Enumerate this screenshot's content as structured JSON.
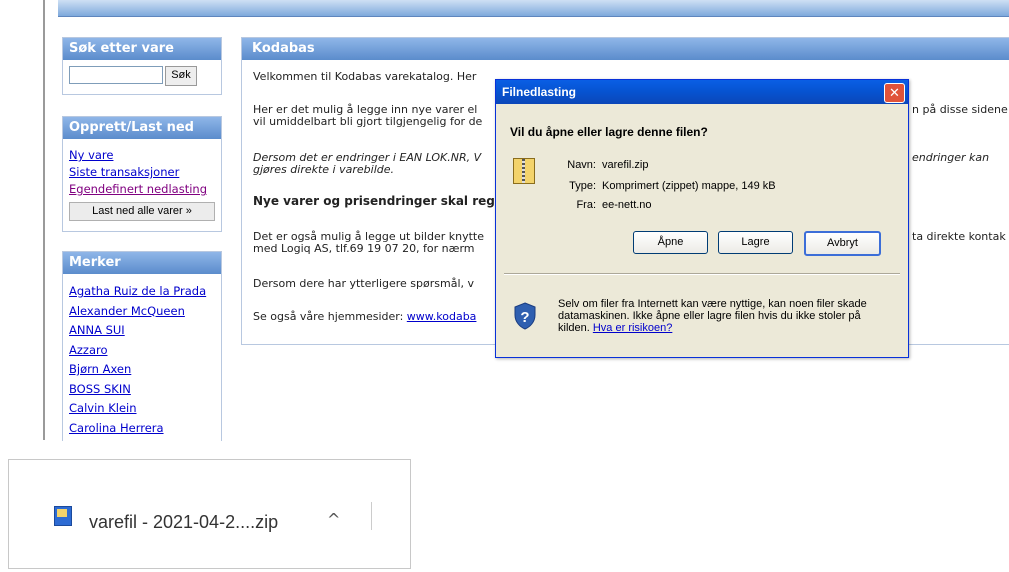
{
  "topbar": {
    "text": ""
  },
  "sidebar": {
    "search": {
      "title": "Søk etter vare",
      "button": "Søk",
      "value": ""
    },
    "create": {
      "title": "Opprett/Last ned",
      "links": [
        "Ny vare",
        "Siste transaksjoner",
        "Egendefinert nedlasting"
      ],
      "download_all": "Last ned alle varer »"
    },
    "brands": {
      "title": "Merker",
      "items": [
        "Agatha Ruiz de la Prada",
        "Alexander McQueen",
        "ANNA SUI",
        "Azzaro",
        "Bjørn Axen",
        "BOSS SKIN",
        "Calvin Klein",
        "Carolina Herrera"
      ]
    }
  },
  "main": {
    "title": "Kodabas",
    "p1": "Velkommen til Kodabas varekatalog. Her",
    "p2a": "Her er det mulig å legge inn nye varer el",
    "p2a_end": "n på disse sidene",
    "p2b": "vil umiddelbart bli gjort tilgjengelig for de",
    "p3a": "Dersom det er endringer i EAN LOK.NR, V",
    "p3a_end": "endringer kan",
    "p3b": "gjøres direkte i varebilde.",
    "h": "Nye varer og prisendringer skal reg",
    "p4a": "Det er også mulig å legge ut bilder knytte",
    "p4a_end": "ta direkte kontak",
    "p4b": "med Logiq AS, tlf.69 19 07 20, for nærm",
    "p5": "Dersom dere har ytterligere spørsmål, v",
    "p6": "Se også våre hjemmesider: ",
    "p6_link": "www.kodaba"
  },
  "dialog": {
    "title": "Filnedlasting",
    "question": "Vil du åpne eller lagre denne filen?",
    "name_label": "Navn:",
    "name_value": "varefil.zip",
    "type_label": "Type:",
    "type_value": "Komprimert (zippet) mappe, 149 kB",
    "from_label": "Fra:",
    "from_value": "ee-nett.no",
    "open": "Åpne",
    "save": "Lagre",
    "cancel": "Avbryt",
    "warning": "Selv om filer fra Internett kan være nyttige, kan noen filer skade datamaskinen. Ikke åpne eller lagre filen hvis du ikke stoler på kilden. ",
    "risk_link": "Hva er risikoen?"
  },
  "download_bar": {
    "filename": "varefil - 2021-04-2....zip"
  }
}
